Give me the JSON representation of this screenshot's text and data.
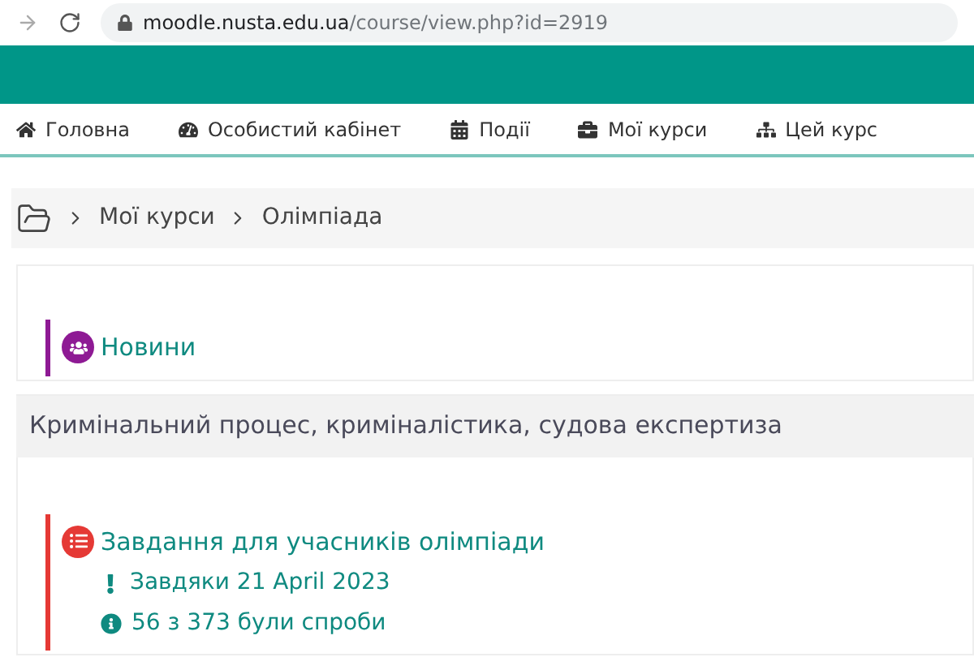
{
  "browser": {
    "url_host": "moodle.nusta.edu.ua",
    "url_path": "/course/view.php?id=2919"
  },
  "nav": [
    {
      "kind": "home",
      "label": "Головна"
    },
    {
      "kind": "dashboard",
      "label": "Особистий кабінет"
    },
    {
      "kind": "calendar",
      "label": "Події"
    },
    {
      "kind": "courses",
      "label": "Мої курси"
    },
    {
      "kind": "course",
      "label": "Цей курс"
    }
  ],
  "breadcrumb": [
    "Мої курси",
    "Олімпіада"
  ],
  "sections": [
    {
      "activities": [
        {
          "kind": "forum",
          "color": "#8e1a94",
          "name": "Новини"
        }
      ]
    },
    {
      "title": "Кримінальний процес, криміналістика, судова експертиза",
      "activities": [
        {
          "kind": "quiz",
          "color": "#e53935",
          "name": "Завдання для учасників олімпіади",
          "details": [
            {
              "kind": "due",
              "text": "Завдяки 21 April 2023"
            },
            {
              "kind": "info",
              "text": "56 з 373 були спроби"
            }
          ]
        }
      ]
    }
  ]
}
